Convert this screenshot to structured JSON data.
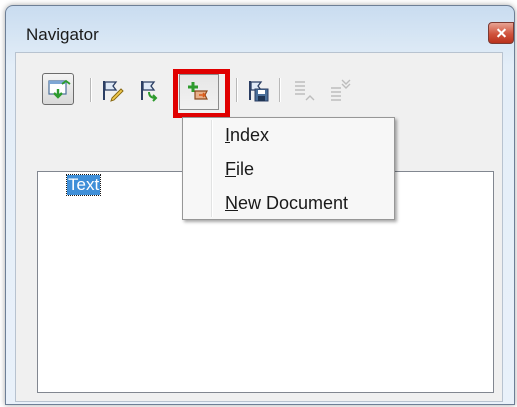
{
  "window": {
    "title": "Navigator"
  },
  "toolbar": {
    "buttons": [
      {
        "name": "toggle-content-view",
        "icon": "navigator-toggle-icon",
        "state": "pressed"
      },
      {
        "name": "edit",
        "icon": "flag-pencil-icon"
      },
      {
        "name": "update",
        "icon": "flag-arrow-icon"
      },
      {
        "name": "insert",
        "icon": "insert-plus-icon",
        "state": "highlighted"
      },
      {
        "name": "save-as",
        "icon": "save-disk-icon"
      },
      {
        "name": "move-up",
        "icon": "move-up-icon",
        "state": "disabled"
      },
      {
        "name": "move-down",
        "icon": "move-down-icon",
        "state": "disabled"
      }
    ],
    "highlight_color": "#e00000"
  },
  "tree": {
    "items": [
      {
        "label": "Text",
        "selected": true
      }
    ]
  },
  "menu": {
    "items": [
      {
        "accel": "I",
        "rest": "ndex"
      },
      {
        "accel": "F",
        "rest": "ile"
      },
      {
        "accel": "N",
        "rest": "ew Document"
      }
    ]
  },
  "colors": {
    "selection": "#3f8fd8",
    "close_button": "#d0533d"
  }
}
